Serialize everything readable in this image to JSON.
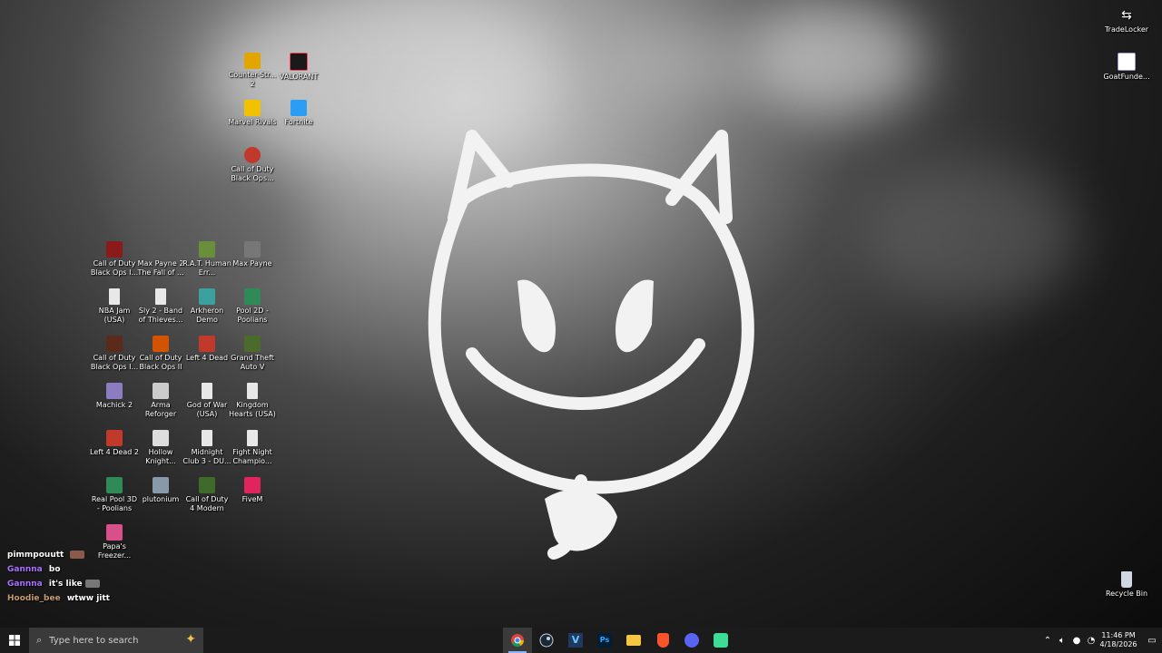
{
  "colors": {
    "taskbar": "#1b1b1b",
    "search_box": "#3a3a3a",
    "chat_purple": "#a970ff",
    "chat_brown": "#c69b6d"
  },
  "desktop": {
    "top_right": [
      {
        "id": "tradelocker",
        "label": "TradeLocker",
        "icon": "tradelocker-icon"
      },
      {
        "id": "goatfunded",
        "label": "GoatFunde...",
        "icon": "goatfunded-icon"
      }
    ],
    "group_top": [
      {
        "id": "counter-strike",
        "label": "Counter-Str... 2",
        "icon": "counter-strike-icon",
        "color": "#e3a500"
      },
      {
        "id": "valorant",
        "label": "VALORANT",
        "icon": "valorant-icon",
        "color": "#fa4454"
      },
      {
        "id": "marvel-rivals",
        "label": "Marvel Rivals",
        "icon": "marvel-rivals-icon",
        "color": "#f2c200"
      },
      {
        "id": "fortnite",
        "label": "Fortnite",
        "icon": "fortnite-icon",
        "color": "#2a9df4"
      },
      {
        "id": "cod-bo-top",
        "label": "Call of Duty Black Ops...",
        "icon": "call-of-duty-icon",
        "color": "#c0392b"
      }
    ],
    "grid": [
      {
        "label": "Call of Duty Black Ops I...",
        "icon": "call-of-duty-icon",
        "color": "#8b1a1a"
      },
      {
        "label": "Max Payne 2 The Fall of ...",
        "icon": "max-payne-2-icon",
        "color": "#555555"
      },
      {
        "label": "R.A.T. Human Err...",
        "icon": "rat-icon",
        "color": "#6a8f3a"
      },
      {
        "label": "Max Payne",
        "icon": "max-payne-icon",
        "color": "#777777"
      },
      {
        "label": "NBA Jam (USA)",
        "icon": "file-icon",
        "color": "#e8e8e8"
      },
      {
        "label": "Sly 2 - Band of Thieves...",
        "icon": "file-icon",
        "color": "#e8e8e8"
      },
      {
        "label": "Arkheron Demo",
        "icon": "arkheron-icon",
        "color": "#3aa0a0"
      },
      {
        "label": "Pool 2D - Poolians",
        "icon": "pool-icon",
        "color": "#2e8b57"
      },
      {
        "label": "Call of Duty Black Ops I...",
        "icon": "call-of-duty-icon",
        "color": "#5a2a1a"
      },
      {
        "label": "Call of Duty Black Ops II",
        "icon": "call-of-duty-icon",
        "color": "#d35400"
      },
      {
        "label": "Left 4 Dead",
        "icon": "left4dead-icon",
        "color": "#c0392b"
      },
      {
        "label": "Grand Theft Auto V",
        "icon": "gta-icon",
        "color": "#4a6b2a"
      },
      {
        "label": "Machick 2",
        "icon": "machick-icon",
        "color": "#8e7cc3"
      },
      {
        "label": "Arma Reforger",
        "icon": "arma-icon",
        "color": "#cccccc"
      },
      {
        "label": "God of War (USA)",
        "icon": "file-icon",
        "color": "#e8e8e8"
      },
      {
        "label": "Kingdom Hearts (USA)",
        "icon": "file-icon",
        "color": "#e8e8e8"
      },
      {
        "label": "Left 4 Dead 2",
        "icon": "left4dead-icon",
        "color": "#c0392b"
      },
      {
        "label": "Hollow Knight...",
        "icon": "hollow-knight-icon",
        "color": "#dddddd"
      },
      {
        "label": "Midnight Club 3 - DU...",
        "icon": "file-icon",
        "color": "#e8e8e8"
      },
      {
        "label": "Fight Night Champio...",
        "icon": "file-icon",
        "color": "#e8e8e8"
      },
      {
        "label": "Real Pool 3D - Poolians",
        "icon": "pool-icon",
        "color": "#2e8b57"
      },
      {
        "label": "plutonium",
        "icon": "plutonium-icon",
        "color": "#8899aa"
      },
      {
        "label": "Call of Duty 4 Modern Wa...",
        "icon": "call-of-duty-icon",
        "color": "#3f6b2a"
      },
      {
        "label": "FiveM",
        "icon": "fivem-icon",
        "color": "#e0245e"
      },
      {
        "label": "Papa's Freezer...",
        "icon": "papas-freezeria-icon",
        "color": "#d94f8a"
      }
    ],
    "recycle_bin": {
      "label": "Recycle Bin",
      "icon": "recycle-bin-icon"
    }
  },
  "chat": [
    {
      "user": "pimmpouutt",
      "text": "",
      "color": "#ffffff",
      "emote": true
    },
    {
      "user": "Gannna",
      "text": "bo",
      "color": "#a970ff",
      "emote": false
    },
    {
      "user": "Gannna",
      "text": "it's like",
      "color": "#a970ff",
      "emote": true
    },
    {
      "user": "Hoodie_bee",
      "text": "wtww jitt",
      "color": "#c69b6d",
      "emote": false
    }
  ],
  "taskbar": {
    "search_placeholder": "Type here to search",
    "apps": [
      {
        "name": "chrome",
        "icon": "chrome-icon",
        "active": true
      },
      {
        "name": "steam",
        "icon": "steam-icon",
        "active": false
      },
      {
        "name": "visual-studio",
        "icon": "visual-studio-icon",
        "active": false
      },
      {
        "name": "photoshop",
        "icon": "photoshop-icon",
        "active": false
      },
      {
        "name": "file-explorer",
        "icon": "folder-icon",
        "active": false
      },
      {
        "name": "brave",
        "icon": "brave-icon",
        "active": false
      },
      {
        "name": "discord",
        "icon": "discord-icon",
        "active": false
      },
      {
        "name": "game-app",
        "icon": "app-icon",
        "active": false
      }
    ],
    "time": "11:46 PM",
    "date": "4/18/2026"
  }
}
